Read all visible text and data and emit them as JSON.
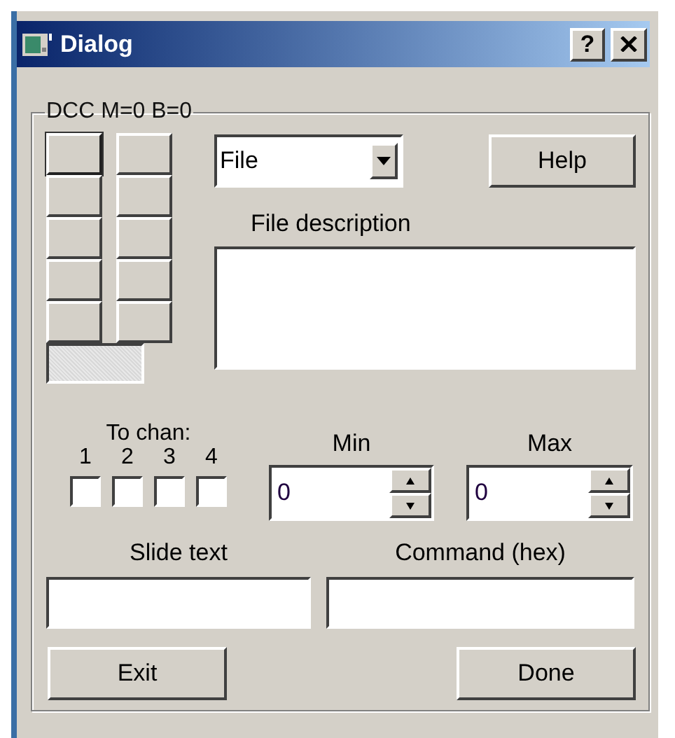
{
  "window": {
    "title": "Dialog",
    "help_glyph": "?"
  },
  "group": {
    "title": "DCC M=0 B=0"
  },
  "button_grid": [
    {
      "selected": true
    },
    {
      "selected": false
    },
    {
      "selected": false
    },
    {
      "selected": false
    },
    {
      "selected": false
    },
    {
      "selected": false
    },
    {
      "selected": false
    },
    {
      "selected": false
    },
    {
      "selected": false
    },
    {
      "selected": false
    }
  ],
  "mode_dropdown": {
    "value": "File"
  },
  "help_button": "Help",
  "description": {
    "label": "File description"
  },
  "channels": {
    "label": "To chan:",
    "items": [
      {
        "label": "1",
        "checked": false
      },
      {
        "label": "2",
        "checked": false
      },
      {
        "label": "3",
        "checked": false
      },
      {
        "label": "4",
        "checked": false
      }
    ]
  },
  "min": {
    "label": "Min",
    "value": "0"
  },
  "max": {
    "label": "Max",
    "value": "0"
  },
  "slide_text": {
    "label": "Slide text"
  },
  "command": {
    "label": "Command (hex)"
  },
  "buttons": [
    "Exit",
    "Done"
  ]
}
